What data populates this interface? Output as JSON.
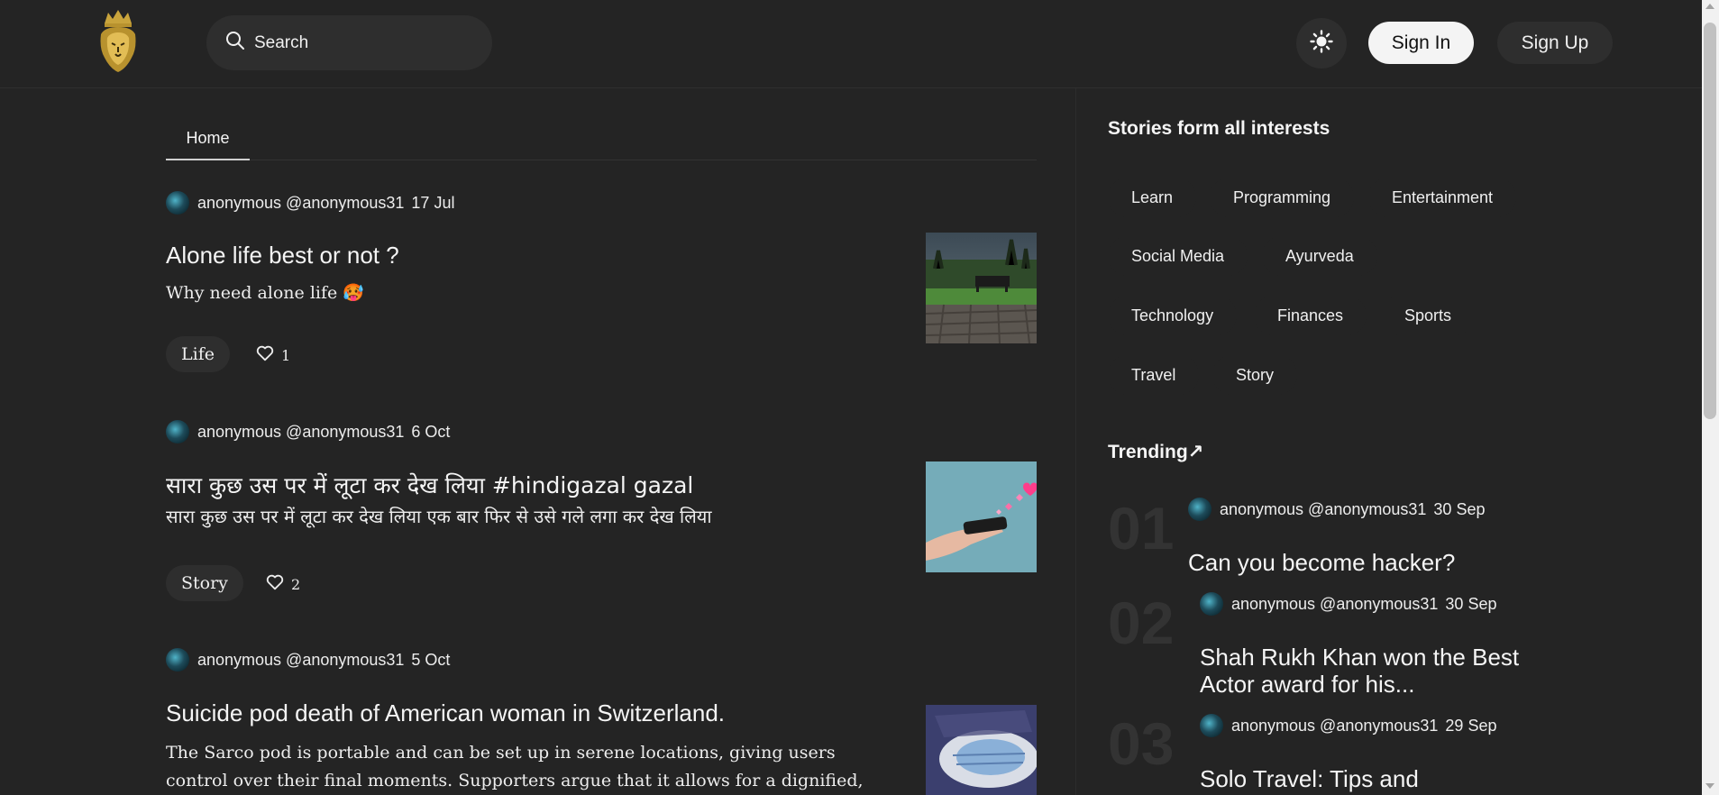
{
  "header": {
    "search_placeholder": "Search",
    "sign_in": "Sign In",
    "sign_up": "Sign Up"
  },
  "tabs": [
    {
      "label": "Home"
    }
  ],
  "posts": [
    {
      "author": "anonymous @anonymous31",
      "date": "17 Jul",
      "title": "Alone life best or not ?",
      "excerpt": "Why need alone life 🥵",
      "tag": "Life",
      "likes": "1"
    },
    {
      "author": "anonymous @anonymous31",
      "date": "6 Oct",
      "title": "सारा कुछ उस पर में लूटा कर देख लिया #hindigazal gazal",
      "excerpt": "सारा कुछ उस पर में लूटा कर देख लिया एक बार फिर से उसे गले लगा कर देख लिया",
      "tag": "Story",
      "likes": "2"
    },
    {
      "author": "anonymous @anonymous31",
      "date": "5 Oct",
      "title": "Suicide pod death of American woman in Switzerland.",
      "excerpt": "The Sarco pod is portable and can be set up in serene locations, giving users control over their final moments. Supporters argue that it allows for a dignified, painless death."
    }
  ],
  "sidebar": {
    "interests_title": "Stories form all interests",
    "interests": [
      "Learn",
      "Programming",
      "Entertainment",
      "Social Media",
      "Ayurveda",
      "Technology",
      "Finances",
      "Sports",
      "Travel",
      "Story"
    ],
    "trending_title": "Trending↗",
    "trending": [
      {
        "rank": "01",
        "author": "anonymous @anonymous31",
        "date": "30 Sep",
        "title": "Can you become hacker?"
      },
      {
        "rank": "02",
        "author": "anonymous @anonymous31",
        "date": "30 Sep",
        "title": "Shah Rukh Khan won the Best Actor award for his..."
      },
      {
        "rank": "03",
        "author": "anonymous @anonymous31",
        "date": "29 Sep",
        "title": "Solo Travel: Tips and"
      }
    ]
  },
  "colors": {
    "background": "#242424",
    "surface": "#2e2e2e",
    "text": "#ececec",
    "sign_in_bg": "#f4f4f4",
    "logo_gold": "#c9a43c"
  },
  "icons": [
    "lion-crown-logo",
    "search-icon",
    "sun-icon",
    "heart-icon"
  ]
}
